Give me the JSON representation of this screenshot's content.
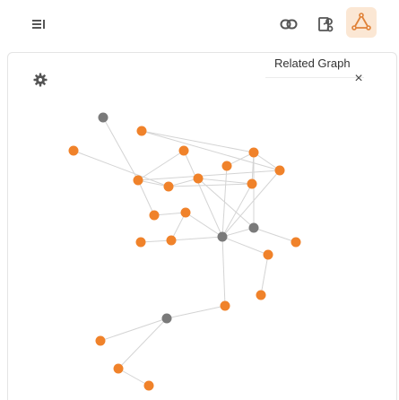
{
  "toolbar": {
    "items": [
      {
        "name": "list-icon",
        "label": ""
      },
      {
        "name": "link-icon",
        "label": ""
      },
      {
        "name": "local-graph-icon",
        "label": ""
      },
      {
        "name": "related-graph-icon",
        "label": ""
      }
    ]
  },
  "panel": {
    "title": "Related Graph",
    "close": "×"
  },
  "colors": {
    "accent": "#f0822a",
    "neutral_node": "#7a7a7a",
    "edge": "#d4d4d4",
    "icon": "#555555"
  },
  "graph": {
    "nodes": [
      {
        "id": 0,
        "kind": "neutral"
      },
      {
        "id": 1,
        "kind": "accent"
      },
      {
        "id": 2,
        "kind": "accent"
      },
      {
        "id": 3,
        "kind": "accent"
      },
      {
        "id": 4,
        "kind": "accent"
      },
      {
        "id": 5,
        "kind": "accent"
      },
      {
        "id": 6,
        "kind": "accent"
      },
      {
        "id": 7,
        "kind": "accent"
      },
      {
        "id": 8,
        "kind": "accent"
      },
      {
        "id": 9,
        "kind": "accent"
      },
      {
        "id": 10,
        "kind": "accent"
      },
      {
        "id": 11,
        "kind": "accent"
      },
      {
        "id": 12,
        "kind": "accent"
      },
      {
        "id": 13,
        "kind": "accent"
      },
      {
        "id": 14,
        "kind": "accent"
      },
      {
        "id": 15,
        "kind": "neutral"
      },
      {
        "id": 16,
        "kind": "neutral"
      },
      {
        "id": 17,
        "kind": "accent"
      },
      {
        "id": 18,
        "kind": "accent"
      },
      {
        "id": 19,
        "kind": "accent"
      },
      {
        "id": 20,
        "kind": "accent"
      },
      {
        "id": 21,
        "kind": "neutral"
      },
      {
        "id": 22,
        "kind": "accent"
      },
      {
        "id": 23,
        "kind": "accent"
      },
      {
        "id": 24,
        "kind": "accent"
      }
    ],
    "edges": [
      [
        0,
        7
      ],
      [
        1,
        8
      ],
      [
        2,
        6
      ],
      [
        6,
        7
      ],
      [
        6,
        5
      ],
      [
        7,
        8
      ],
      [
        8,
        9
      ],
      [
        8,
        10
      ],
      [
        9,
        10
      ],
      [
        2,
        5
      ],
      [
        5,
        4
      ],
      [
        5,
        16
      ],
      [
        5,
        10
      ],
      [
        4,
        15
      ],
      [
        10,
        15
      ],
      [
        12,
        14
      ],
      [
        14,
        15
      ],
      [
        13,
        14
      ],
      [
        11,
        12
      ],
      [
        12,
        15
      ],
      [
        11,
        7
      ],
      [
        3,
        7
      ],
      [
        3,
        15
      ],
      [
        16,
        15
      ],
      [
        16,
        17
      ],
      [
        15,
        18
      ],
      [
        18,
        19
      ],
      [
        15,
        20
      ],
      [
        20,
        21
      ],
      [
        21,
        22
      ],
      [
        21,
        23
      ],
      [
        23,
        24
      ],
      [
        15,
        6
      ],
      [
        9,
        16
      ]
    ]
  }
}
